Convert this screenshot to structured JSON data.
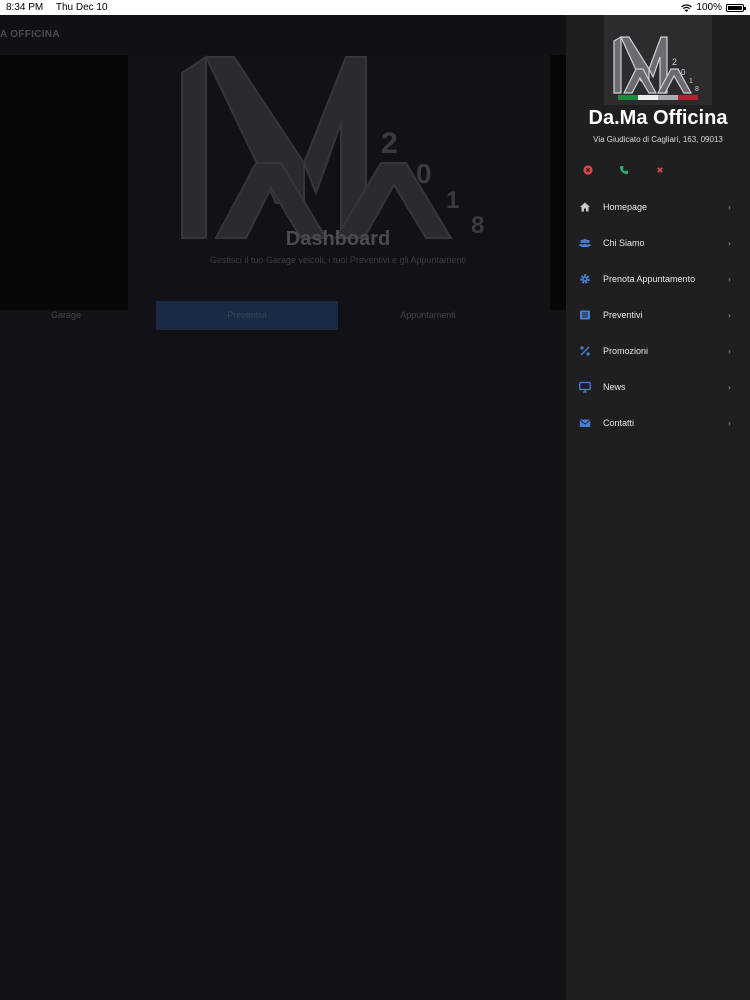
{
  "status_bar": {
    "time": "8:34 PM",
    "date": "Thu Dec 10",
    "battery": "100%"
  },
  "app": {
    "title": "A OFFICINA",
    "dashboard_title": "Dashboard",
    "dashboard_subtitle": "Gestisci il tuo Garage veicoli, i tuoi Preventivi e gli Appuntamenti",
    "tabs": [
      {
        "label": "Garage",
        "active": false
      },
      {
        "label": "Preventivi",
        "active": true
      },
      {
        "label": "Appuntamenti",
        "active": false
      }
    ]
  },
  "drawer": {
    "business_name": "Da.Ma Officina",
    "address": "Via Giudicato di Cagliari, 163, 09013",
    "logo_year_digits": [
      "2",
      "0",
      "1",
      "8"
    ],
    "quick_actions": [
      {
        "icon": "close-circle-icon",
        "color": "#e0484f"
      },
      {
        "icon": "phone-icon",
        "color": "#2fb36e"
      },
      {
        "icon": "close-icon",
        "color": "#e0484f"
      }
    ],
    "menu": [
      {
        "label": "Homepage",
        "icon": "home-icon"
      },
      {
        "label": "Chi Siamo",
        "icon": "users-icon"
      },
      {
        "label": "Prenota Appuntamento",
        "icon": "gear-icon"
      },
      {
        "label": "Preventivi",
        "icon": "list-icon"
      },
      {
        "label": "Promozioni",
        "icon": "percent-icon"
      },
      {
        "label": "News",
        "icon": "monitor-icon"
      },
      {
        "label": "Contatti",
        "icon": "envelope-icon"
      }
    ],
    "chevron": "›"
  },
  "colors": {
    "accent": "#4a7fd6",
    "drawer_bg": "#1f1f22",
    "app_bg": "#111116",
    "active_tab": "#1b2a44"
  }
}
